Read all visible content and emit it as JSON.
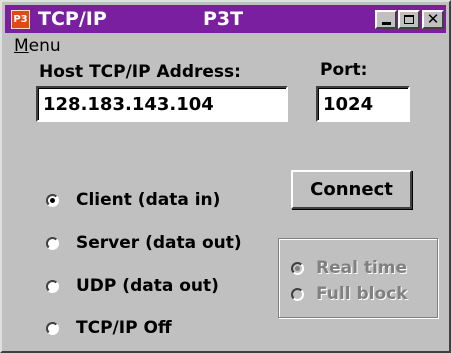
{
  "titlebar": {
    "icon_text": "P3",
    "title": "TCP/IP",
    "subtitle": "P3T",
    "color": "#7a1fa0"
  },
  "menu": {
    "label_first": "M",
    "label_rest": "enu"
  },
  "host": {
    "label": "Host TCP/IP Address:",
    "value": "128.183.143.104"
  },
  "port": {
    "label": "Port:",
    "value": "1024"
  },
  "connect_button": "Connect",
  "modes": [
    {
      "label": "Client (data in)",
      "selected": true
    },
    {
      "label": "Server (data out)",
      "selected": false
    },
    {
      "label": "UDP (data out)",
      "selected": false
    },
    {
      "label": "TCP/IP Off",
      "selected": false
    }
  ],
  "transfer": [
    {
      "label": "Real time",
      "selected": true
    },
    {
      "label": "Full block",
      "selected": false
    }
  ],
  "icons": [
    "minimize-icon",
    "maximize-icon",
    "close-icon"
  ]
}
